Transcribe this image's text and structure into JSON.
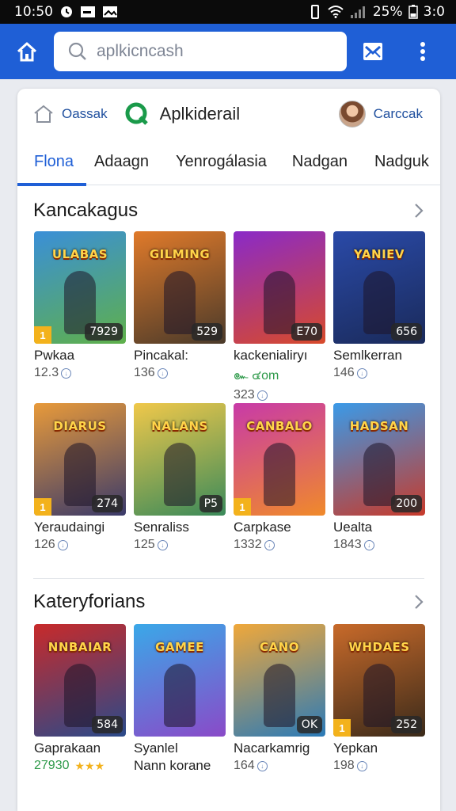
{
  "status_bar": {
    "time": "10:50",
    "battery": "25%",
    "right_time": "3:0"
  },
  "search": {
    "placeholder": "aplkicncash"
  },
  "header": {
    "left_label": "Oassak",
    "brand_label": "Aplkiderail",
    "right_label": "Carccak"
  },
  "tabs": [
    {
      "label": "Flona",
      "active": true
    },
    {
      "label": "Adaagn"
    },
    {
      "label": "Yenrogálasia"
    },
    {
      "label": "Nadgan"
    },
    {
      "label": "Nadguk"
    }
  ],
  "sections": [
    {
      "title": "Kancakagus",
      "games": [
        {
          "name": "Pwkaa",
          "count": "12.3",
          "art_title": "ULABAS",
          "badge": "7929",
          "corner": "1",
          "colors": [
            "#3a8fd8",
            "#5fb04a"
          ]
        },
        {
          "name": "Pincakal:",
          "count": "136",
          "art_title": "GILMING",
          "badge": "529",
          "corner": "",
          "colors": [
            "#e07a2a",
            "#4a3a2a"
          ]
        },
        {
          "name": "kackenialiryı",
          "meta": "๛ ๔om",
          "count": "323",
          "art_title": "",
          "badge": "E70",
          "corner": "",
          "colors": [
            "#8a2ac8",
            "#d84a2a"
          ]
        },
        {
          "name": "Semlkerran",
          "count": "146",
          "art_title": "YANIEV",
          "badge": "656",
          "corner": "",
          "colors": [
            "#2a4aa8",
            "#1a2a5a"
          ]
        }
      ]
    },
    {
      "games": [
        {
          "name": "Yeraudaingi",
          "count": "126",
          "art_title": "DIARUS",
          "badge": "274",
          "corner": "1",
          "colors": [
            "#e89a3a",
            "#3a3a6a"
          ]
        },
        {
          "name": "Senraliss",
          "count": "125",
          "art_title": "NALANS",
          "badge": "P5",
          "corner": "",
          "colors": [
            "#f0c84a",
            "#3a8a5a"
          ]
        },
        {
          "name": "Carpkase",
          "count": "1332",
          "art_title": "CANBALO",
          "badge": "",
          "corner": "1",
          "colors": [
            "#c83aa8",
            "#f08a2a"
          ]
        },
        {
          "name": "Uealta",
          "count": "1843",
          "art_title": "HADSAN",
          "badge": "200",
          "corner": "",
          "colors": [
            "#3a9ae8",
            "#c83a2a"
          ]
        }
      ]
    },
    {
      "title": "Kateryforians",
      "games": [
        {
          "name": "Gaprakaan",
          "count": "27930",
          "stars": "★★★",
          "art_title": "NNBAIAR",
          "badge": "584",
          "corner": "",
          "colors": [
            "#c82a2a",
            "#2a4a8a"
          ]
        },
        {
          "name": "Syanlel",
          "sub": "Nann korane",
          "count": "",
          "art_title": "GAMEE",
          "badge": "",
          "corner": "",
          "colors": [
            "#3aa8e8",
            "#8a4ac8"
          ]
        },
        {
          "name": "Nacarkamrig",
          "count": "164",
          "art_title": "CANO",
          "badge": "OK",
          "corner": "",
          "colors": [
            "#f0a83a",
            "#2a7ab8"
          ]
        },
        {
          "name": "Yepkan",
          "count": "198",
          "art_title": "WHDAES",
          "badge": "252",
          "corner": "1",
          "colors": [
            "#c86a2a",
            "#3a2a1a"
          ]
        }
      ]
    }
  ]
}
